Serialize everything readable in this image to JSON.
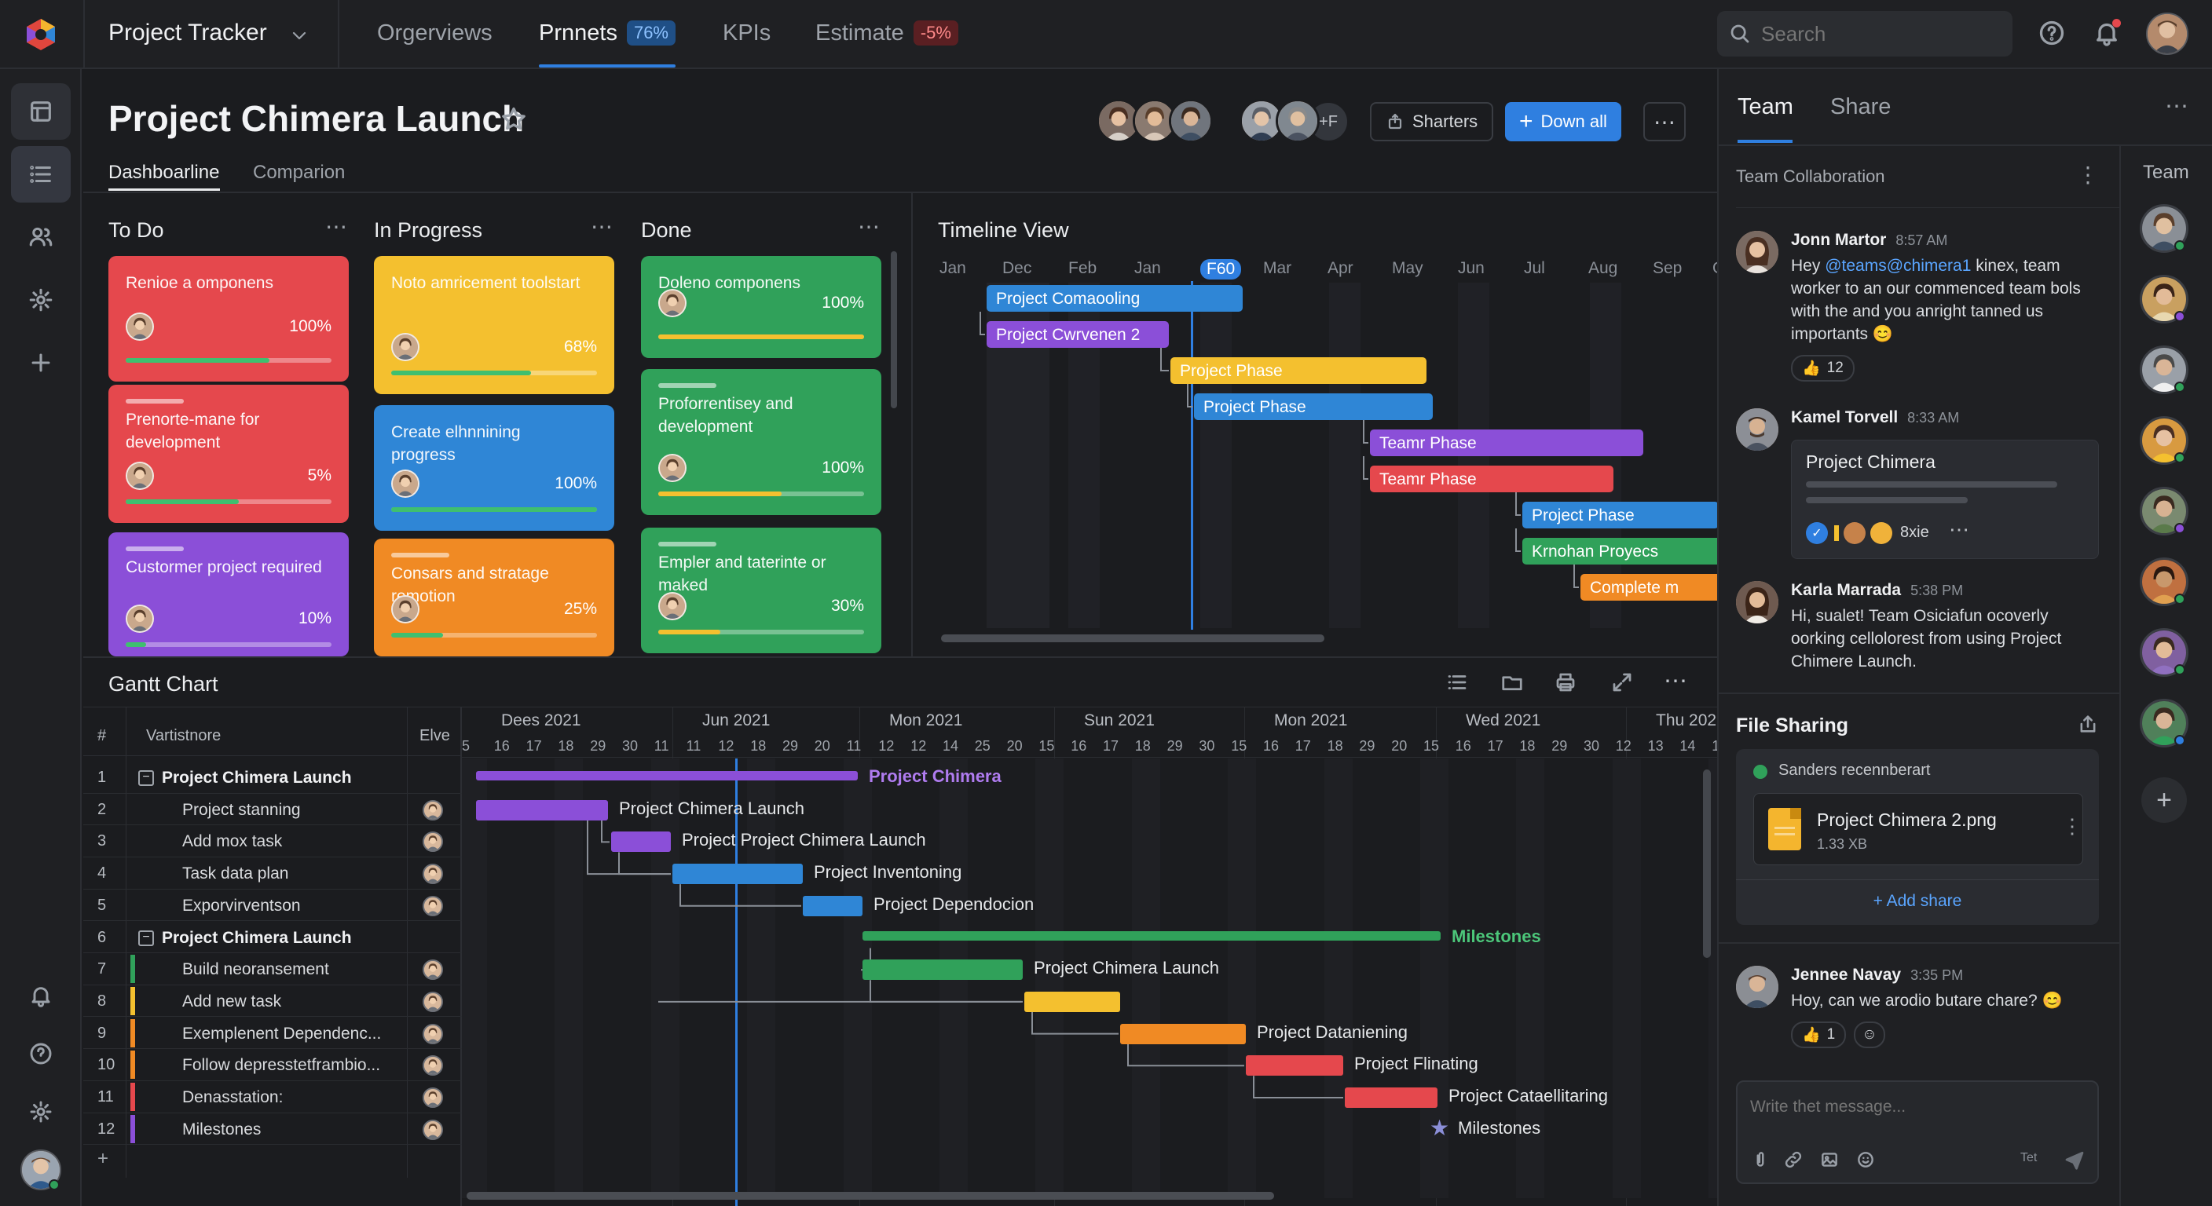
{
  "colors": {
    "red": "#e5484d",
    "orange": "#f08a24",
    "yellow": "#f4c02f",
    "green": "#30a15a",
    "blue": "#2f86d6",
    "purple": "#8b4fd8",
    "accent": "#2f7fe0"
  },
  "topbar": {
    "app_title": "Project Tracker",
    "tabs": [
      "Orgerviews",
      "Prnnets",
      "KPIs",
      "Estimate"
    ],
    "tab_badges": {
      "prnnets": "76%",
      "estimate": "-5%"
    },
    "search_placeholder": "Search"
  },
  "header": {
    "title": "Project Chimera Launch",
    "subtabs": [
      "Dashboarline",
      "Comparion"
    ],
    "more_members": "+F",
    "share_button": "Sharters",
    "primary_button": "Down all"
  },
  "kanban": {
    "columns": [
      {
        "title": "To Do",
        "cards": [
          {
            "text": "Renioe a omponens",
            "percent": "100%",
            "progress": 0.7,
            "color": "red"
          },
          {
            "text": "Prenorte-mane for development",
            "percent": "5%",
            "progress": 0.55,
            "color": "red"
          },
          {
            "text": "Custormer project required",
            "percent": "10%",
            "progress": 0.1,
            "color": "purple"
          }
        ]
      },
      {
        "title": "In Progress",
        "cards": [
          {
            "text": "Noto amricement toolstart",
            "percent": "68%",
            "progress": 0.68,
            "color": "yellow"
          },
          {
            "text": "Create elhnnining progress",
            "percent": "100%",
            "progress": 1,
            "color": "blue"
          },
          {
            "text": "Consars and stratage remotion",
            "percent": "25%",
            "progress": 0.25,
            "color": "orange"
          }
        ]
      },
      {
        "title": "Done",
        "cards": [
          {
            "text": "Doleno componens",
            "percent": "100%",
            "progress": 1,
            "color": "green"
          },
          {
            "text": "Proforrentisey and development",
            "percent": "100%",
            "progress": 0.6,
            "color": "green"
          },
          {
            "text": "Empler and taterinte or maked",
            "percent": "30%",
            "progress": 0.3,
            "color": "green"
          }
        ]
      }
    ]
  },
  "timeline": {
    "title": "Timeline View",
    "months": [
      "Jan",
      "Dec",
      "Feb",
      "Jan",
      "F60",
      "Mar",
      "Apr",
      "May",
      "Jun",
      "Jul",
      "Aug",
      "Sep",
      "Oc"
    ],
    "bars": [
      {
        "label": "Project Comaooling",
        "color": "blue"
      },
      {
        "label": "Project Cwrvenen 2",
        "color": "purple"
      },
      {
        "label": "Project Phase",
        "color": "yellow"
      },
      {
        "label": "Project Phase",
        "color": "blue"
      },
      {
        "label": "Teamr Phase",
        "color": "purple"
      },
      {
        "label": "Teamr Phase",
        "color": "red"
      },
      {
        "label": "Project Phase",
        "color": "blue"
      },
      {
        "label": "Krnohan Proyecs",
        "color": "green"
      },
      {
        "label": "Complete m",
        "color": "orange"
      }
    ]
  },
  "gantt": {
    "title": "Gantt Chart",
    "col_num": "#",
    "col_name": "Vartistnore",
    "col_elve": "Elve",
    "dates": [
      "Dees 2021",
      "Jun 2021",
      "Mon 2021",
      "Sun 2021",
      "Mon 2021",
      "Wed 2021",
      "Thu 202"
    ],
    "days": [
      "5",
      "16",
      "17",
      "18",
      "29",
      "30",
      "11",
      "11",
      "12",
      "18",
      "29",
      "20",
      "11",
      "12",
      "12",
      "14",
      "25",
      "20",
      "15",
      "16",
      "17",
      "18",
      "29",
      "30",
      "15",
      "16",
      "17",
      "18",
      "29",
      "20",
      "15",
      "16",
      "17",
      "18",
      "29",
      "30",
      "12",
      "13",
      "14",
      "15"
    ],
    "rows": [
      {
        "n": "1",
        "name": "Project Chimera Launch",
        "group": true
      },
      {
        "n": "2",
        "name": "Project stanning"
      },
      {
        "n": "3",
        "name": "Add mox task"
      },
      {
        "n": "4",
        "name": "Task data plan"
      },
      {
        "n": "5",
        "name": "Exporvirventson"
      },
      {
        "n": "6",
        "name": "Project Chimera Launch",
        "group": true
      },
      {
        "n": "7",
        "name": "Build neoransement",
        "stripe": "green"
      },
      {
        "n": "8",
        "name": "Add new task",
        "stripe": "yellow"
      },
      {
        "n": "9",
        "name": "Exemplenent Dependenc...",
        "stripe": "orange"
      },
      {
        "n": "10",
        "name": "Follow depresstetframbio...",
        "stripe": "orange"
      },
      {
        "n": "11",
        "name": "Denasstation:",
        "stripe": "red"
      },
      {
        "n": "12",
        "name": "Milestones",
        "stripe": "purple"
      }
    ],
    "add_row": "+",
    "bar_labels": [
      "Project Chimera",
      "Project Chimera Launch",
      "Project Project Chimera Launch",
      "Project Inventoning",
      "Project Dependocion",
      "Milestones",
      "Project Chimera Launch",
      "Project Dataniening",
      "Project Flinating",
      "Project Cataellitaring",
      "Milestones"
    ]
  },
  "right": {
    "tabs": [
      "Team",
      "Share"
    ],
    "section": "Team Collaboration",
    "team_label": "Team",
    "messages": [
      {
        "name": "Jonn Martor",
        "time": "8:57 AM",
        "mention": "@teams@chimera1",
        "text_pre": "Hey ",
        "text_post": " kinex, team worker to an our commenced team bols with the and you anright tanned us importants 😊",
        "react_count": "12"
      },
      {
        "name": "Kamel Torvell",
        "time": "8:33 AM",
        "card_title": "Project Chimera",
        "card_more": "8xie"
      },
      {
        "name": "Karla Marrada",
        "time": "5:38 PM",
        "text": "Hi, sualet! Team Osiciafun ocoverly oorking cellolorest from using Project Chimere Launch."
      }
    ],
    "file_sharing": {
      "title": "File Sharing",
      "status": "Sanders recennberart",
      "file_name": "Project Chimera 2.png",
      "file_size": "1.33 XB",
      "add_share": "+ Add share"
    },
    "last_message": {
      "name": "Jennee Navay",
      "time": "3:35 PM",
      "text": "Hoy, can we arodio butare chare? 😊",
      "react_count": "1"
    },
    "composer_placeholder": "Write thet message...",
    "composer_tag": "Tet"
  }
}
